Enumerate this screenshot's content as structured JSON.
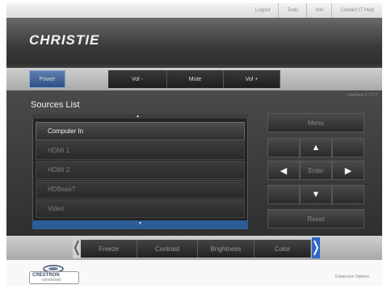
{
  "topbar": {
    "links": [
      "Logout",
      "Tools",
      "Info",
      "Contact IT Help"
    ]
  },
  "brand": {
    "logo_text": "CHRISTIE"
  },
  "controls": {
    "power": "Power",
    "vol_down": "Vol -",
    "mute": "Mute",
    "vol_up": "Vol +"
  },
  "sources": {
    "title": "Sources List",
    "version": "Interface 2.7.2.7",
    "items": [
      "Computer In",
      "HDMI 1",
      "HDMI 2",
      "HDBaseT",
      "Video"
    ],
    "selected": "Computer In"
  },
  "remote": {
    "menu": "Menu",
    "enter": "Enter",
    "reset": "Reset"
  },
  "bottom": {
    "items": [
      "Freeze",
      "Contrast",
      "Brightness",
      "Color"
    ]
  },
  "footer": {
    "crestron": "CRESTRON",
    "crestron_sub": "connected",
    "expansion": "Expansion Options"
  },
  "colors": {
    "accent": "#2c5d97",
    "power": "#3e6299",
    "nav_blue": "#2e67c8"
  }
}
